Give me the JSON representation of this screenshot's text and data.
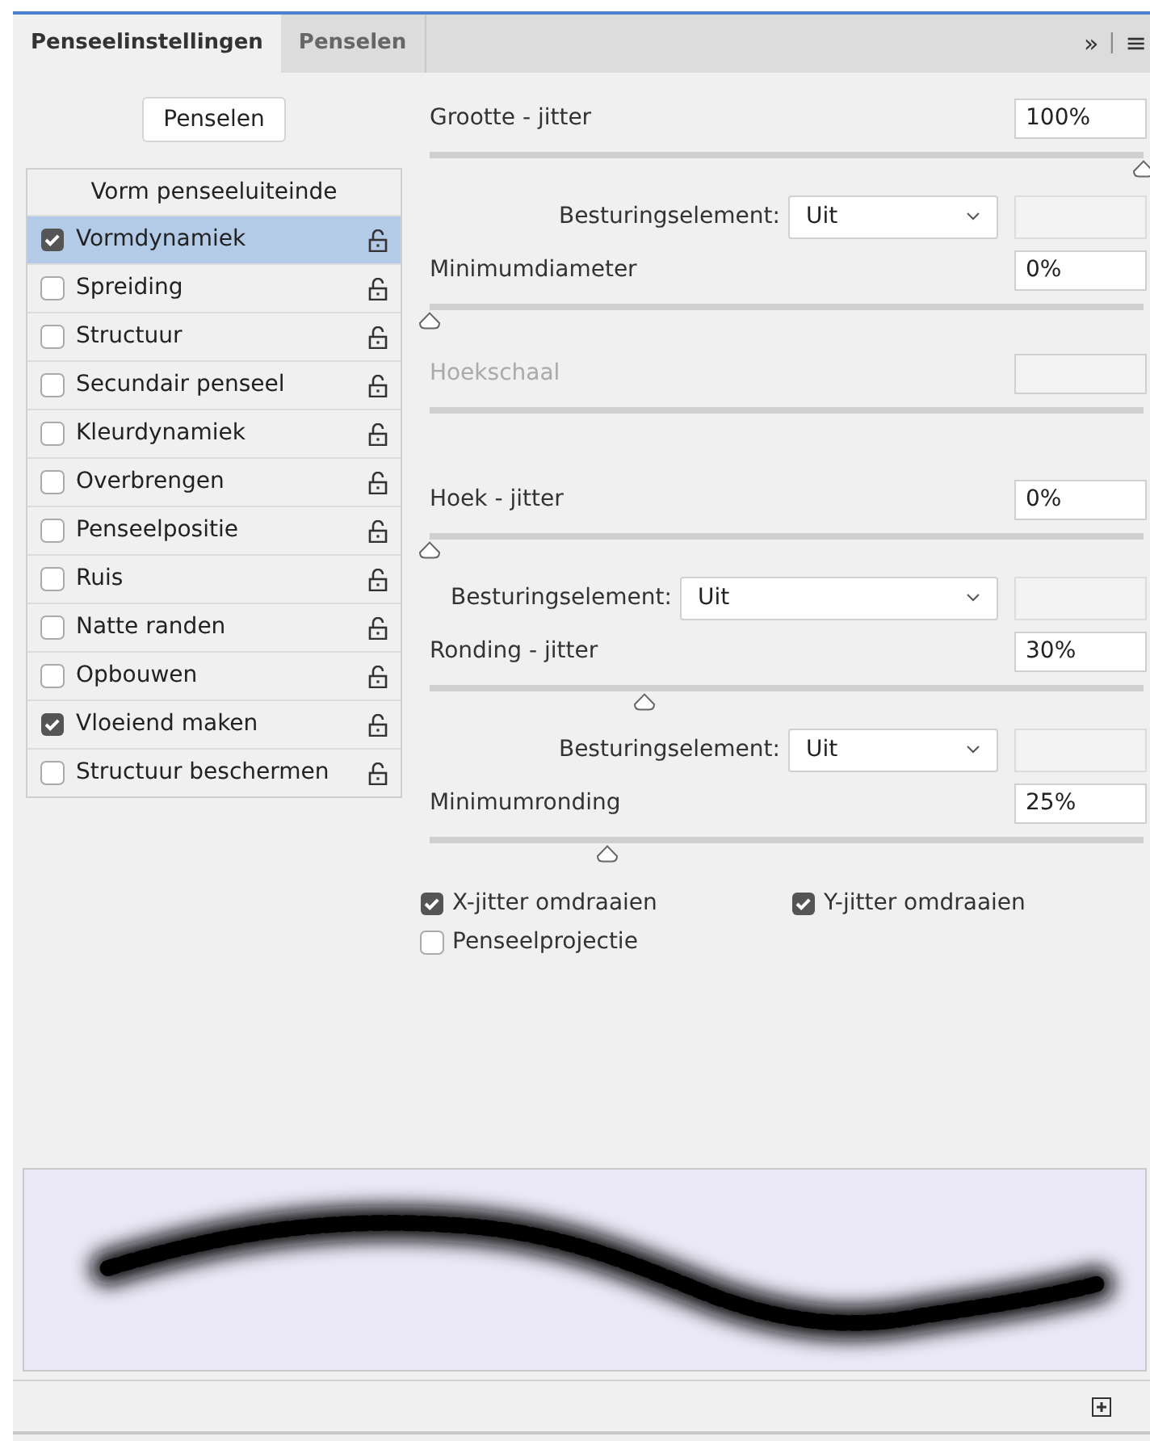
{
  "tabs": [
    {
      "label": "Penseelinstellingen",
      "selected": true
    },
    {
      "label": "Penselen",
      "selected": false
    }
  ],
  "panel_menu": {
    "expand": "»",
    "separator": "|",
    "menu": "≡"
  },
  "brushes_button": "Penselen",
  "brush_tip_header": "Vorm penseeluiteinde",
  "options": [
    {
      "label": "Vormdynamiek",
      "checked": true,
      "selected": true
    },
    {
      "label": "Spreiding",
      "checked": false,
      "selected": false
    },
    {
      "label": "Structuur",
      "checked": false,
      "selected": false
    },
    {
      "label": "Secundair penseel",
      "checked": false,
      "selected": false
    },
    {
      "label": "Kleurdynamiek",
      "checked": false,
      "selected": false
    },
    {
      "label": "Overbrengen",
      "checked": false,
      "selected": false
    },
    {
      "label": "Penseelpositie",
      "checked": false,
      "selected": false
    },
    {
      "label": "Ruis",
      "checked": false,
      "selected": false
    },
    {
      "label": "Natte randen",
      "checked": false,
      "selected": false
    },
    {
      "label": "Opbouwen",
      "checked": false,
      "selected": false
    },
    {
      "label": "Vloeiend maken",
      "checked": true,
      "selected": false
    },
    {
      "label": "Structuur beschermen",
      "checked": false,
      "selected": false
    }
  ],
  "settings": [
    {
      "kind": "slider",
      "label": "Grootte - jitter",
      "value": "100%",
      "level": 1,
      "disabled": false
    },
    {
      "kind": "control",
      "label": "Besturingselement:",
      "dropdown": "Uit"
    },
    {
      "kind": "slider",
      "label": "Minimumdiameter",
      "value": "0%",
      "level": 0,
      "disabled": false
    },
    {
      "kind": "slider",
      "label": "Hoekschaal",
      "disabled": true
    },
    {
      "kind": "spacer"
    },
    {
      "kind": "slider",
      "label": "Hoek - jitter",
      "value": "0%",
      "level": 0,
      "disabled": false
    },
    {
      "kind": "control_wide",
      "label": "Besturingselement:",
      "dropdown": "Uit"
    },
    {
      "kind": "slider",
      "label": "Ronding - jitter",
      "value": "30%",
      "level": 0.3,
      "disabled": false
    },
    {
      "kind": "control",
      "label": "Besturingselement:",
      "dropdown": "Uit"
    },
    {
      "kind": "slider",
      "label": "Minimumronding",
      "value": "25%",
      "level": 0.25,
      "disabled": false
    }
  ],
  "flips": [
    {
      "label": "X-jitter omdraaien",
      "checked": true
    },
    {
      "label": "Y-jitter omdraaien",
      "checked": true
    },
    {
      "label": "Penseelprojectie",
      "checked": false
    }
  ]
}
